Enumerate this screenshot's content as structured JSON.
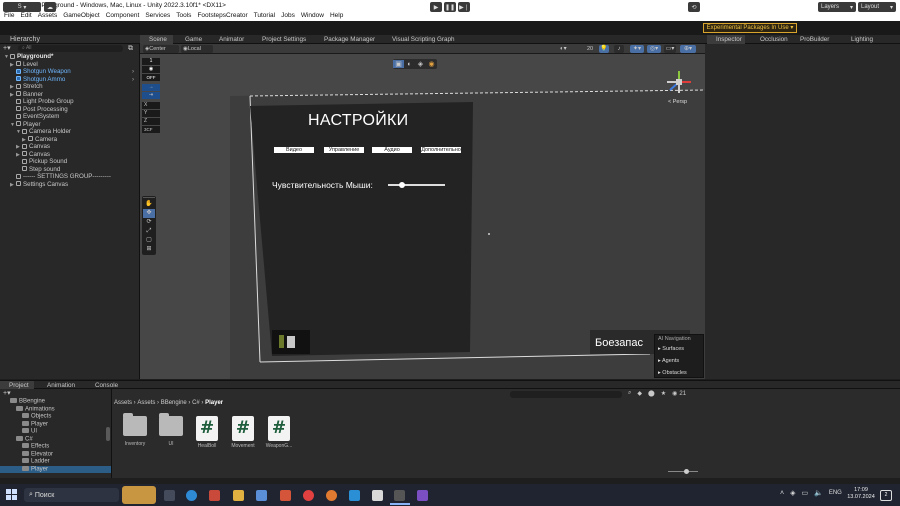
{
  "window": {
    "title": "MERZOST - Playground - Windows, Mac, Linux - Unity 2022.3.10f1* <DX11>",
    "controls": [
      "—",
      "☐",
      "✕"
    ]
  },
  "menu": [
    "File",
    "Edit",
    "Assets",
    "GameObject",
    "Component",
    "Services",
    "Tools",
    "FootstepsCreator",
    "Tutorial",
    "Jobs",
    "Window",
    "Help"
  ],
  "toolbar": {
    "account": "S",
    "experimental": "Experimental Packages In Use ▾",
    "layers": "Layers",
    "layout": "Layout"
  },
  "hierarchy": {
    "tab": "Hierarchy",
    "search_placeholder": "All",
    "items": [
      {
        "label": "Playground*",
        "depth": 0,
        "arrow": "▼",
        "type": "scene"
      },
      {
        "label": "Level",
        "depth": 1,
        "arrow": "▶",
        "type": "object"
      },
      {
        "label": "Shotgun Weapon",
        "depth": 1,
        "arrow": "",
        "type": "prefab"
      },
      {
        "label": "Shotgun Ammo",
        "depth": 1,
        "arrow": "",
        "type": "prefab"
      },
      {
        "label": "Stretch",
        "depth": 1,
        "arrow": "▶",
        "type": "object"
      },
      {
        "label": "Banner",
        "depth": 1,
        "arrow": "▶",
        "type": "object"
      },
      {
        "label": "Light Probe Group",
        "depth": 1,
        "arrow": "",
        "type": "object"
      },
      {
        "label": "Post Processing",
        "depth": 1,
        "arrow": "",
        "type": "object"
      },
      {
        "label": "EventSystem",
        "depth": 1,
        "arrow": "",
        "type": "object"
      },
      {
        "label": "Player",
        "depth": 1,
        "arrow": "▼",
        "type": "object"
      },
      {
        "label": "Camera Holder",
        "depth": 2,
        "arrow": "▼",
        "type": "object"
      },
      {
        "label": "Camera",
        "depth": 3,
        "arrow": "▶",
        "type": "object"
      },
      {
        "label": "Canvas",
        "depth": 2,
        "arrow": "▶",
        "type": "object"
      },
      {
        "label": "Canvas",
        "depth": 2,
        "arrow": "▶",
        "type": "object"
      },
      {
        "label": "Pickup Sound",
        "depth": 2,
        "arrow": "",
        "type": "object"
      },
      {
        "label": "Step sound",
        "depth": 2,
        "arrow": "",
        "type": "object"
      },
      {
        "label": "------ SETTINGS GROUP---------",
        "depth": 1,
        "arrow": "",
        "type": "object"
      },
      {
        "label": "Settings Canvas",
        "depth": 1,
        "arrow": "▶",
        "type": "object"
      }
    ]
  },
  "scene_tabs": [
    "Scene",
    "Game",
    "Animator",
    "Project Settings",
    "Package Manager",
    "Visual Scripting Graph"
  ],
  "scene_toolbar": {
    "pivot": "Center",
    "space": "Local",
    "grid_size": "20"
  },
  "overlay_left": {
    "values": [
      "1",
      "OFF"
    ],
    "axes": [
      "X",
      "Y",
      "Z"
    ],
    "mode": "3CF"
  },
  "gizmo": {
    "label": "< Persp"
  },
  "scene_ui": {
    "heading": "НАСТРОЙКИ",
    "tabs": [
      "Видео",
      "Управление",
      "Аудио",
      "Дополнительно"
    ],
    "sensitivity_label": "Чувствительность Мыши:",
    "sensitivity_value": 0.25,
    "ammo_label": "Боезапас"
  },
  "ai_navigation": {
    "title": "AI Navigation",
    "items": [
      "Surfaces",
      "Agents",
      "Obstacles"
    ]
  },
  "inspector_tabs": [
    "Inspector",
    "Occlusion",
    "ProBuilder",
    "Lighting"
  ],
  "project": {
    "tabs": [
      "Project",
      "Animation",
      "Console"
    ],
    "breadcrumb": [
      "Assets",
      "BBengine",
      "C#",
      "Player"
    ],
    "count": "21",
    "tree": [
      {
        "label": "BBengine",
        "depth": 1
      },
      {
        "label": "Animations",
        "depth": 2
      },
      {
        "label": "Objects",
        "depth": 3
      },
      {
        "label": "Player",
        "depth": 3
      },
      {
        "label": "UI",
        "depth": 3
      },
      {
        "label": "C#",
        "depth": 2
      },
      {
        "label": "Effects",
        "depth": 3
      },
      {
        "label": "Elevator",
        "depth": 3
      },
      {
        "label": "Ladder",
        "depth": 3
      },
      {
        "label": "Player",
        "depth": 3
      }
    ],
    "assets": [
      {
        "label": "Inventory",
        "kind": "folder"
      },
      {
        "label": "UI",
        "kind": "folder"
      },
      {
        "label": "HealBoll",
        "kind": "script"
      },
      {
        "label": "Movement",
        "kind": "script"
      },
      {
        "label": "WeaponG...",
        "kind": "script"
      }
    ]
  },
  "taskbar": {
    "search": "Поиск",
    "lang": "ENG",
    "time": "17:09",
    "date": "13.07.2024",
    "notifications": "2"
  }
}
